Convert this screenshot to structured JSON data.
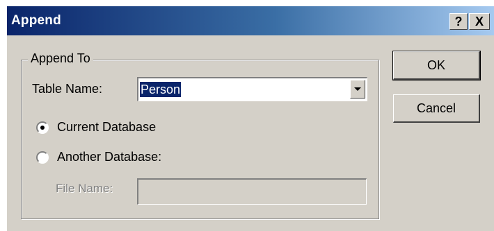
{
  "window": {
    "title": "Append",
    "help_label": "?",
    "close_label": "X"
  },
  "group": {
    "label": "Append To"
  },
  "table_name": {
    "label": "Table Name:",
    "value": "Person"
  },
  "options": {
    "current_database": {
      "label": "Current Database",
      "checked": true
    },
    "another_database": {
      "label": "Another Database:",
      "checked": false
    }
  },
  "file_name": {
    "label": "File Name:",
    "value": "",
    "enabled": false
  },
  "buttons": {
    "ok_label": "OK",
    "cancel_label": "Cancel"
  },
  "colors": {
    "titlebar_start": "#0a246a",
    "titlebar_end": "#a6caf0",
    "face": "#d4d0c8",
    "selection": "#0a246a"
  }
}
